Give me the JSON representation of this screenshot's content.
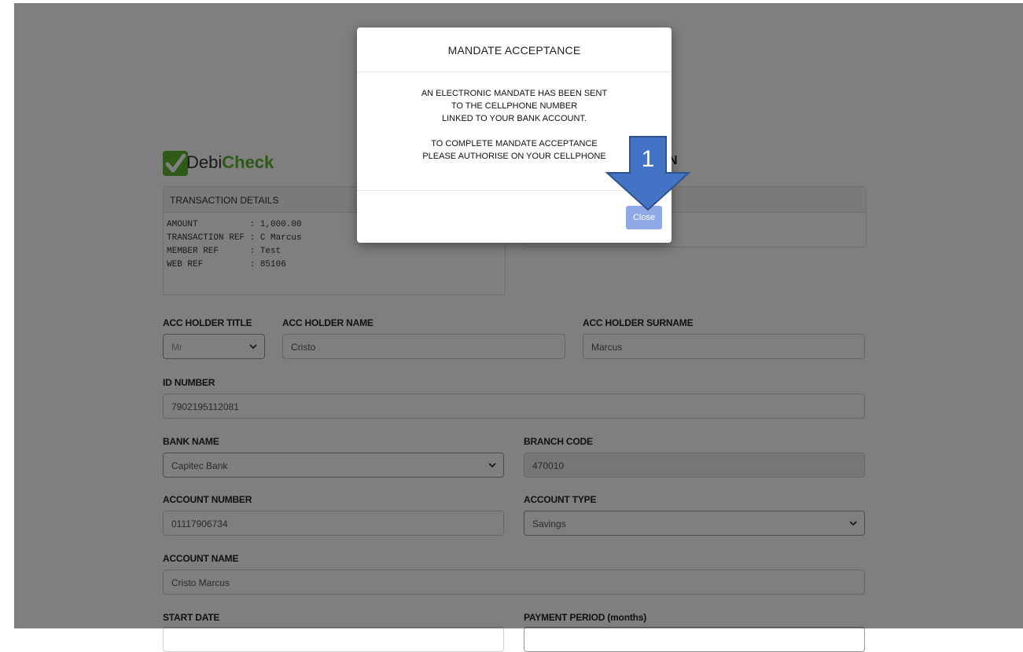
{
  "brand": {
    "logo_prefix": "Debi",
    "logo_suffix": "Check",
    "right_heading_tail": "N"
  },
  "transaction": {
    "header": "TRANSACTION DETAILS",
    "lines": [
      "AMOUNT          : 1,000.00",
      "TRANSACTION REF : C Marcus",
      "MEMBER REF      : Test",
      "WEB REF         : 85106"
    ]
  },
  "form": {
    "title_label": "ACC HOLDER TITLE",
    "title_value": "Mr",
    "name_label": "ACC HOLDER NAME",
    "name_value": "Cristo",
    "surname_label": "ACC HOLDER SURNAME",
    "surname_value": "Marcus",
    "id_label": "ID NUMBER",
    "id_value": "7902195112081",
    "bank_label": "BANK NAME",
    "bank_value": "Capitec Bank",
    "branch_label": "BRANCH CODE",
    "branch_value": "470010",
    "acc_number_label": "ACCOUNT NUMBER",
    "acc_number_value": "01117906734",
    "acc_type_label": "ACCOUNT TYPE",
    "acc_type_value": "Savings",
    "acc_name_label": "ACCOUNT NAME",
    "acc_name_value": "Cristo Marcus",
    "start_date_label": "START DATE",
    "payment_period_label": "PAYMENT PERIOD (months)"
  },
  "modal": {
    "title": "MANDATE ACCEPTANCE",
    "body_lines": [
      "AN ELECTRONIC MANDATE HAS BEEN SENT",
      "TO THE CELLPHONE NUMBER",
      "LINKED TO YOUR BANK ACCOUNT.",
      "",
      "TO COMPLETE MANDATE ACCEPTANCE",
      "PLEASE AUTHORISE ON YOUR CELLPHONE"
    ],
    "close_label": "Close"
  },
  "annotation": {
    "step_number": "1",
    "arrow_color": "#4472c4"
  },
  "colors": {
    "logo_green": "#5cb531",
    "button_blue": "#8fa8e6"
  }
}
